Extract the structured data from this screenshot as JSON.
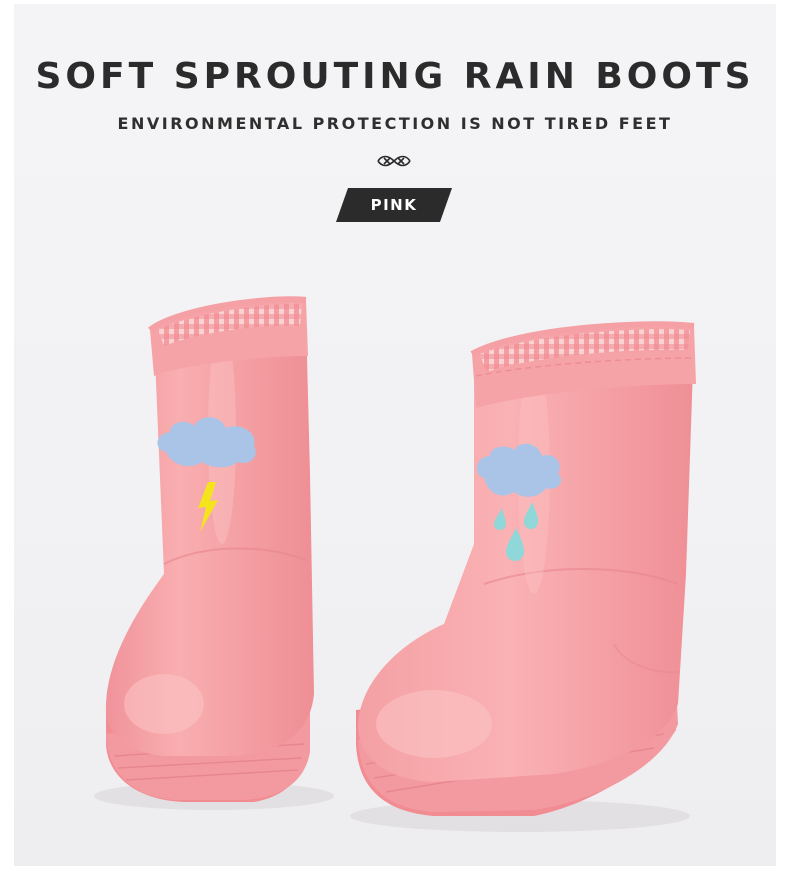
{
  "title": "SOFT SPROUTING RAIN BOOTS",
  "subtitle": "ENVIRONMENTAL PROTECTION IS NOT TIRED FEET",
  "color_tag": "PINK",
  "colors": {
    "boot": "#f7a3a6",
    "lining": "#f08890",
    "cloud": "#a9c4e6",
    "lightning": "#f4e41c",
    "raindrop": "#8fd7d9",
    "text": "#2b2b2b"
  },
  "icons": [
    "knot-ornament-icon",
    "cloud-icon",
    "lightning-icon",
    "raindrop-icon"
  ]
}
